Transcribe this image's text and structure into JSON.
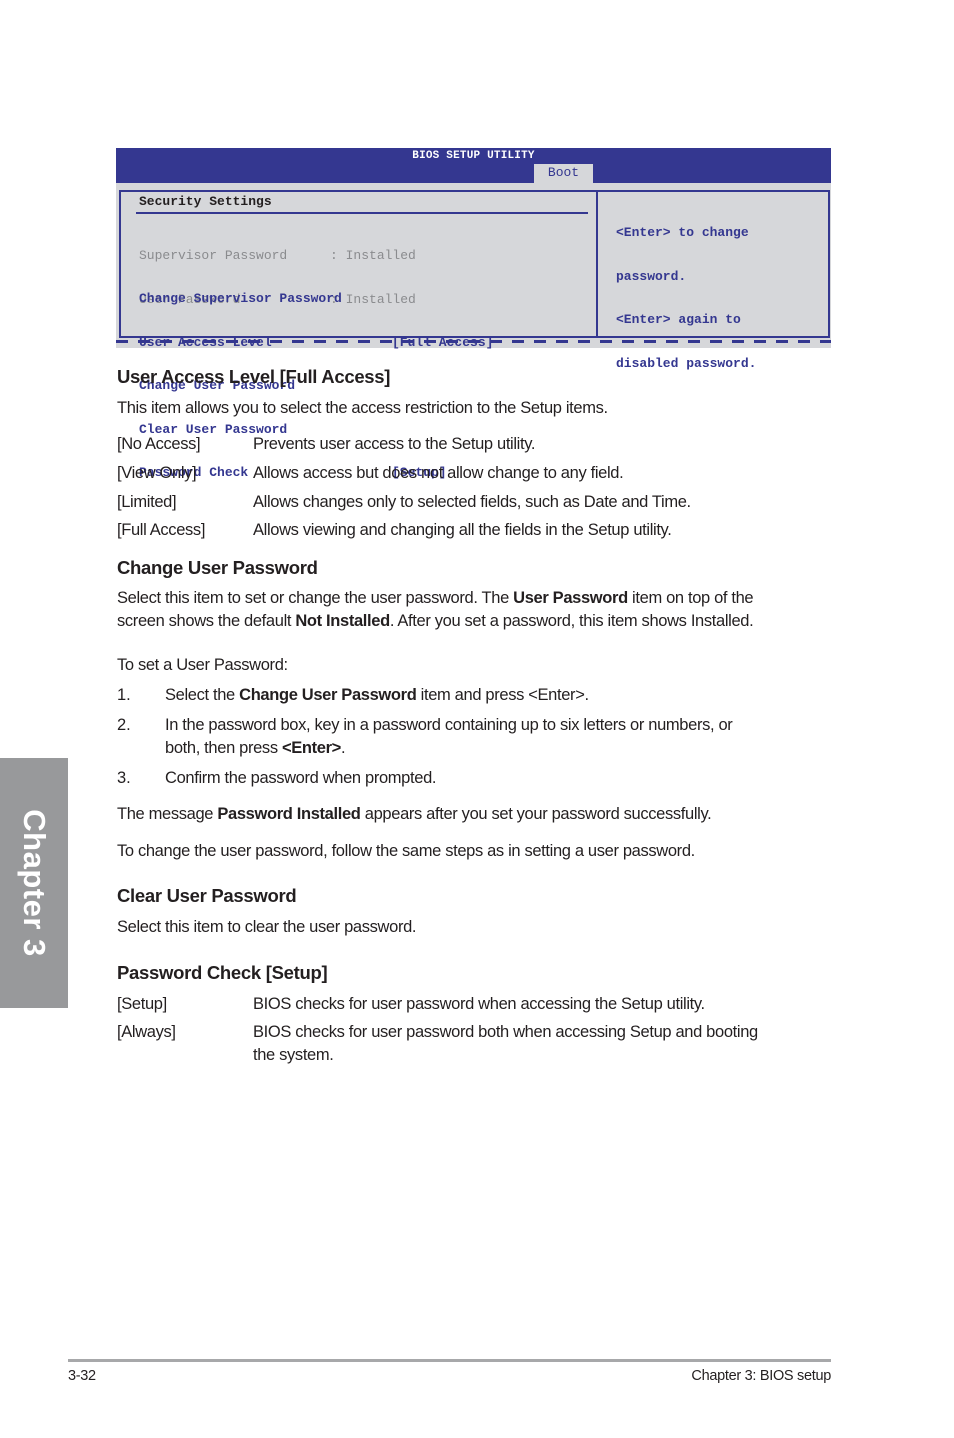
{
  "bios": {
    "title": "BIOS SETUP UTILITY",
    "active_tab": "Boot",
    "section_title": "Security Settings",
    "info_rows": [
      {
        "label": "Supervisor Password",
        "sep": ":",
        "value": "Installed"
      },
      {
        "label": "User Password",
        "sep": ":",
        "value": "Installed"
      }
    ],
    "items": [
      {
        "label": "Change Supervisor Password",
        "value": ""
      },
      {
        "label": "User Access Level",
        "value": "[Full Access]"
      },
      {
        "label": "Change User Password",
        "value": ""
      },
      {
        "label": "Clear User Password",
        "value": ""
      },
      {
        "label": "Password Check",
        "value": "[Setup]"
      }
    ],
    "help_lines": [
      "<Enter> to change",
      "password.",
      "<Enter> again to",
      "disabled password."
    ],
    "colors": {
      "header": "#343790",
      "panel": "#d6d7da",
      "item_text": "#343790",
      "info_text": "#8a8b8e"
    }
  },
  "sections": {
    "user_access": {
      "heading": "User Access Level [Full Access]",
      "intro": "This item allows you to select the access restriction to the Setup items.",
      "options": [
        {
          "term": "[No Access]",
          "desc": "Prevents user access to the Setup utility."
        },
        {
          "term": "[View Only]",
          "desc": "Allows access but does not allow change to any field."
        },
        {
          "term": "[Limited]",
          "desc": "Allows changes only to selected fields, such as Date and Time."
        },
        {
          "term": "[Full Access]",
          "desc": "Allows viewing and changing all the fields in the Setup utility."
        }
      ]
    },
    "change_password": {
      "heading": "Change User Password",
      "para1": {
        "a": "Select this item to set or change the user password. The ",
        "b1": "User Password",
        "c": " item on top of the"
      },
      "para1_line2": {
        "a": "screen shows the default ",
        "b1": "Not Installed",
        "c": ". After you set a password, this item shows Installed."
      },
      "steps_intro": "To set a User Password:",
      "steps": [
        {
          "num": "1.",
          "a": "Select the ",
          "b": "Change User Password",
          "c": " item and press <Enter>."
        },
        {
          "num": "2.",
          "a": "In the password box, key in a password containing up to six letters or numbers, or",
          "a2": "both, then press ",
          "b": "<Enter>",
          "c": "."
        },
        {
          "num": "3.",
          "a": "Confirm the password when prompted."
        }
      ],
      "message": {
        "a": "The message ",
        "b": "Password Installed",
        "c": " appears after you set your password successfully."
      },
      "change_note": "To change the user password, follow the same steps as in setting a user password."
    },
    "clear_password": {
      "heading": "Clear User Password",
      "text": "Select this item to clear the user password."
    },
    "password_check": {
      "heading": "Password Check [Setup]",
      "options": [
        {
          "term": "[Setup]",
          "desc": "BIOS checks for user password when accessing the Setup utility."
        },
        {
          "term": "[Always]",
          "desc": "BIOS checks for user password both when accessing Setup and booting",
          "desc2": "the system."
        }
      ]
    }
  },
  "chapter_tab": "Chapter 3",
  "footer": {
    "page_number": "3-32",
    "chapter_title": "Chapter 3: BIOS setup"
  }
}
